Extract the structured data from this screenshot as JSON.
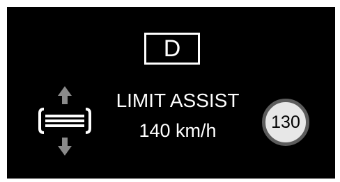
{
  "display": {
    "gear": "D",
    "mode_label": "LIMIT ASSIST",
    "set_speed": "140 km/h",
    "speed_sign_value": "130",
    "icons": {
      "assist": "limit-assist-icon",
      "speed_sign": "speed-limit-sign-icon"
    },
    "colors": {
      "background": "#000000",
      "text": "#ffffff",
      "sign_face": "#e7e7e7",
      "sign_ring": "#5c5c5c",
      "icon_gray": "#8a8a8a"
    }
  }
}
